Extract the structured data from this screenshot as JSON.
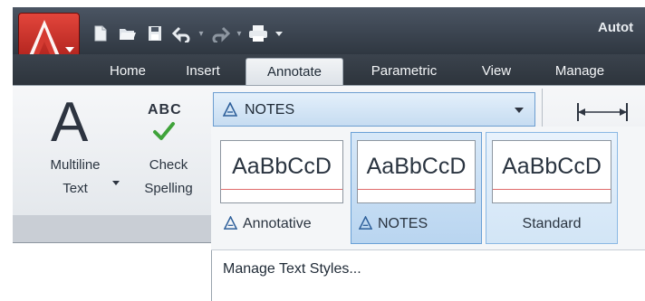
{
  "window": {
    "title_fragment": "Autot"
  },
  "quick_access": {
    "icons": [
      "new-icon",
      "open-icon",
      "save-icon",
      "undo-icon",
      "redo-icon",
      "plot-icon",
      "customize-dropdown-icon"
    ]
  },
  "tabs": [
    {
      "label": "Home",
      "active": false
    },
    {
      "label": "Insert",
      "active": false
    },
    {
      "label": "Annotate",
      "active": true
    },
    {
      "label": "Parametric",
      "active": false
    },
    {
      "label": "View",
      "active": false
    },
    {
      "label": "Manage",
      "active": false
    }
  ],
  "ribbon": {
    "multiline_text": {
      "glyph": "A",
      "label_line1": "Multiline",
      "label_line2": "Text"
    },
    "check_spelling": {
      "glyph": "ABC",
      "label_line1": "Check",
      "label_line2": "Spelling"
    },
    "text_style_combo": {
      "value": "NOTES"
    }
  },
  "gallery": {
    "items": [
      {
        "sample": "AaBbCcD",
        "caption": "Annotative",
        "annotative": true,
        "state": "normal"
      },
      {
        "sample": "AaBbCcD",
        "caption": "NOTES",
        "annotative": true,
        "state": "selected"
      },
      {
        "sample": "AaBbCcD",
        "caption": "Standard",
        "annotative": false,
        "state": "hover"
      }
    ],
    "manage_label": "Manage Text Styles..."
  },
  "colors": {
    "title_bar": "#2f3741",
    "app_button": "#c0261e",
    "combo_highlight": "#c6dcf1",
    "check_mark": "#3fa33a"
  }
}
